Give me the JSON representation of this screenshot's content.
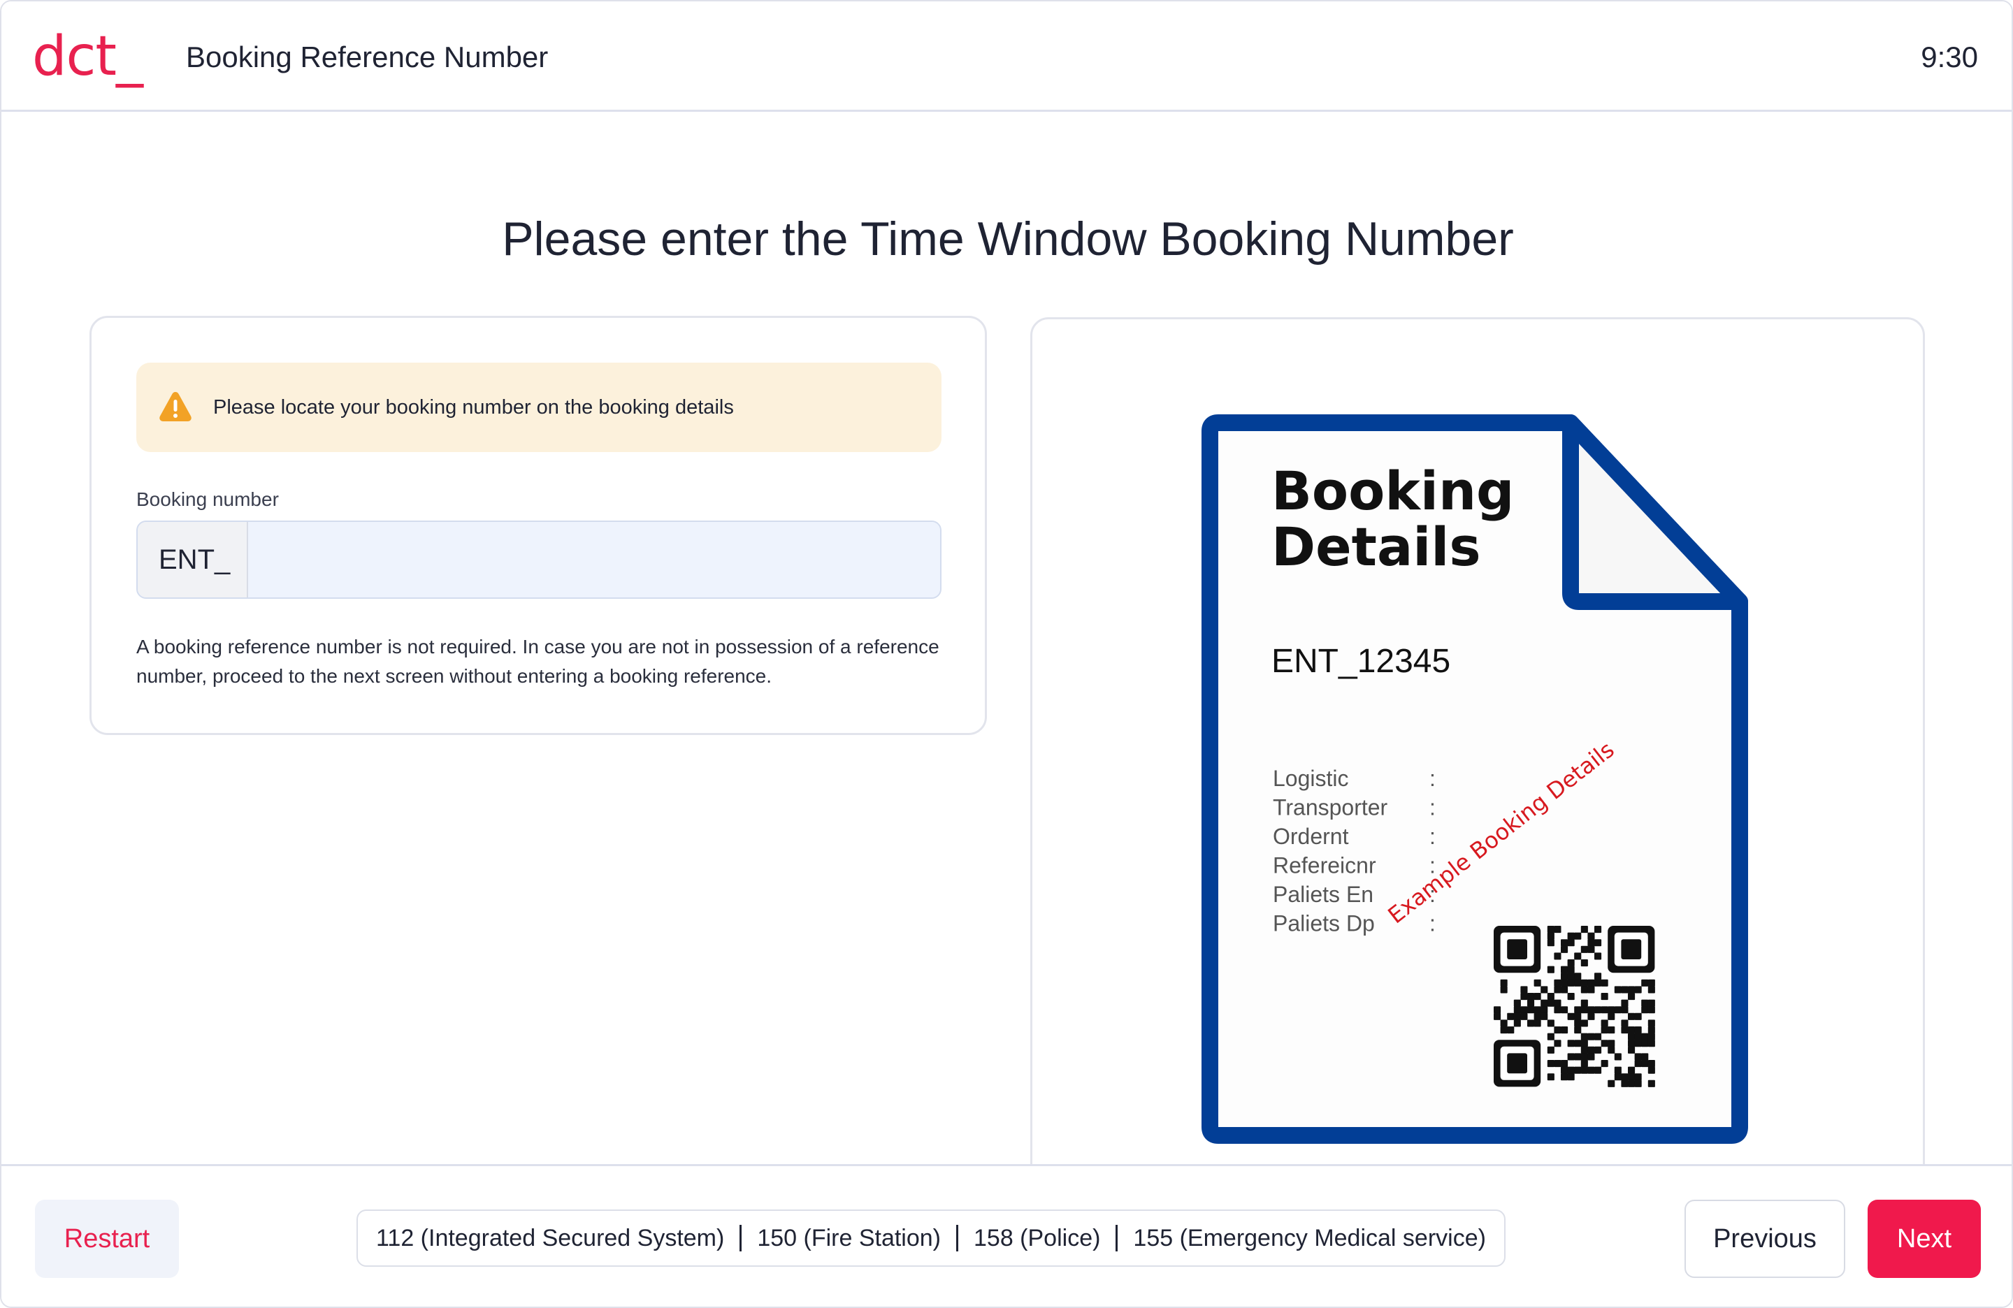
{
  "header": {
    "logo": "dct_",
    "title": "Booking Reference Number",
    "clock": "9:30"
  },
  "main": {
    "heading": "Please enter the Time Window Booking Number"
  },
  "form": {
    "alert_text": "Please locate your booking number on the booking details",
    "alert_icon": "warning-icon",
    "field_label": "Booking number",
    "prefix": "ENT_",
    "value": "",
    "help_text": "A booking reference number is not required. In case you are not in possession of a reference number, proceed to the next screen without entering a booking reference."
  },
  "example_document": {
    "title_line1": "Booking",
    "title_line2": "Details",
    "reference": "ENT_12345",
    "fields": [
      "Logistic",
      "Transporter",
      "Ordernt",
      "Refereicnr",
      "Paliets En",
      "Paliets Dp"
    ],
    "separator": ":",
    "watermark": "Example Booking Details",
    "border_color": "#023e96",
    "watermark_color": "#d7191f"
  },
  "footer": {
    "restart_label": "Restart",
    "emergency_numbers": [
      "112 (Integrated Secured System)",
      "150 (Fire Station)",
      "158 (Police)",
      "155 (Emergency Medical service)"
    ],
    "previous_label": "Previous",
    "next_label": "Next"
  },
  "colors": {
    "accent": "#e8214f",
    "next_button": "#f0194c",
    "alert_bg": "#fcf1dc",
    "input_bg": "#eef3fd"
  }
}
